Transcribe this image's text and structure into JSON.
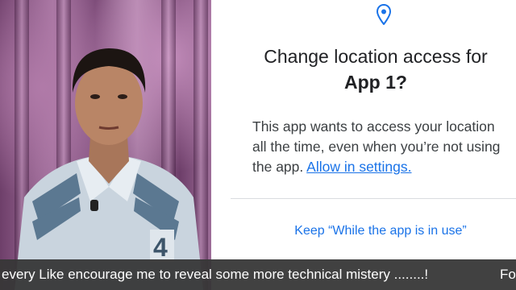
{
  "dialog": {
    "title_line1": "Change location access for",
    "title_line2": "App 1?",
    "body_text": "This app wants to access your location all the time, even when you’re not using the app. ",
    "allow_link": "Allow in settings.",
    "keep_button": "Keep “While the app is in use”"
  },
  "ticker": {
    "text": "every Like encourage me to reveal some more technical mistery ........!",
    "tail": "Fo"
  },
  "colors": {
    "accent": "#1a73e8",
    "ticker_bg": "#373737"
  }
}
